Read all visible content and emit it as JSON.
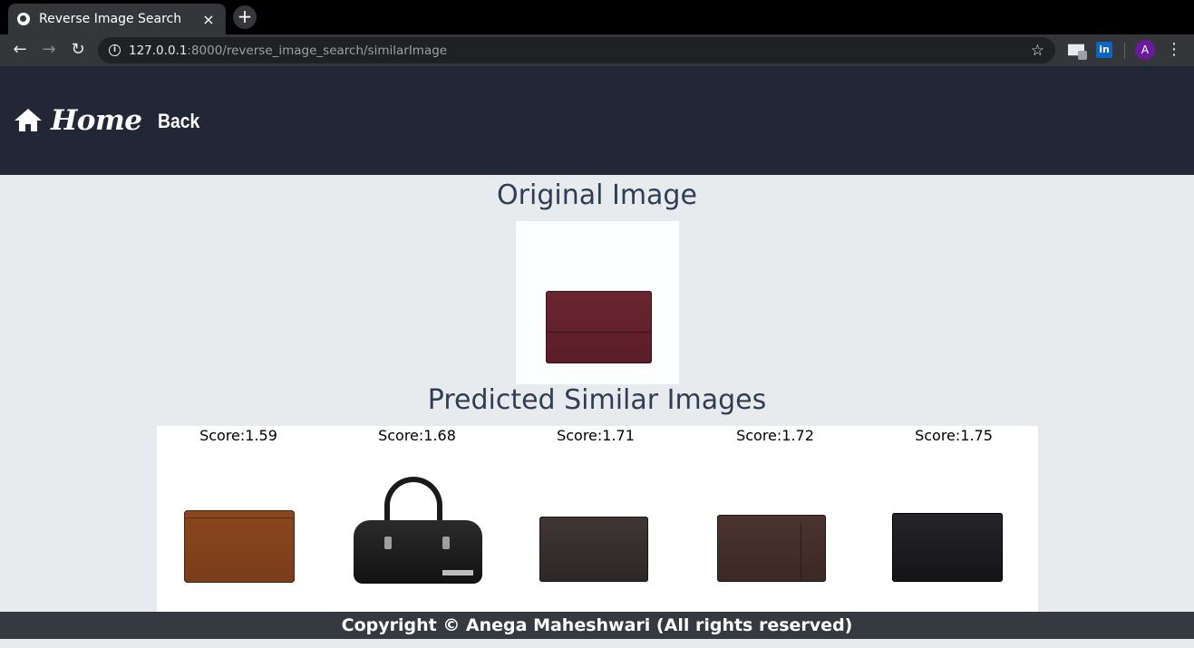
{
  "browser": {
    "tab_title": "Reverse Image Search",
    "tab_close": "×",
    "new_tab": "+",
    "url_host": "127.0.0.1",
    "url_rest": ":8000/reverse_image_search/similarImage",
    "avatar_letter": "A",
    "linkedin_label": "in",
    "icons": [
      "back-arrow-icon",
      "forward-arrow-icon",
      "reload-icon",
      "info-icon",
      "bookmark-star-icon",
      "mail-extension-icon",
      "linkedin-extension-icon",
      "menu-dots-icon"
    ]
  },
  "navbar": {
    "home_label": "Home",
    "back_label": "Back",
    "background": "#212735"
  },
  "main": {
    "original_heading": "Original Image",
    "predicted_heading": "Predicted Similar Images",
    "results": [
      {
        "score": "Score:1.59",
        "item": "brown wallet"
      },
      {
        "score": "Score:1.68",
        "item": "black handbag"
      },
      {
        "score": "Score:1.71",
        "item": "dark brown wallet"
      },
      {
        "score": "Score:1.72",
        "item": "brown leather wallet"
      },
      {
        "score": "Score:1.75",
        "item": "black wallet"
      }
    ]
  },
  "footer": {
    "text": "Copyright © Anega Maheshwari (All rights reserved)",
    "background": "#343a40"
  }
}
